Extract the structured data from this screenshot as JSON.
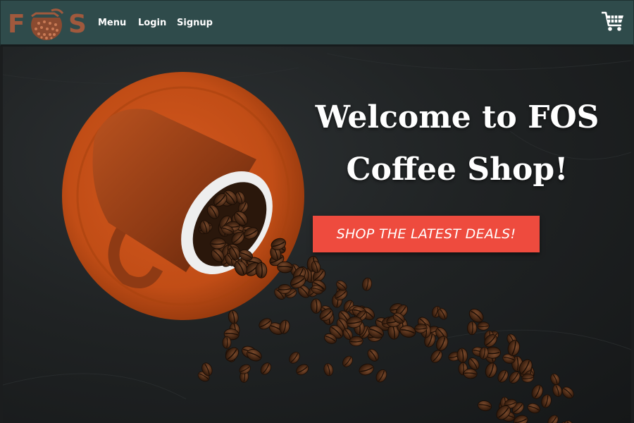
{
  "brand": {
    "logo_left": "F",
    "logo_right": "S",
    "logo_icon": "coffee-pot-icon",
    "logo_color": "#a0593d"
  },
  "nav": {
    "items": [
      {
        "label": "Menu"
      },
      {
        "label": "Login"
      },
      {
        "label": "Signup"
      }
    ],
    "cart_icon": "shopping-cart-icon",
    "background": "#2f4b4b"
  },
  "hero": {
    "title_line1": "Welcome to FOS",
    "title_line2": "Coffee Shop!",
    "cta_label": "SHOP THE LATEST DEALS!",
    "cta_color": "#ee4b3e",
    "image": "coffee-cup-with-spilled-beans"
  }
}
